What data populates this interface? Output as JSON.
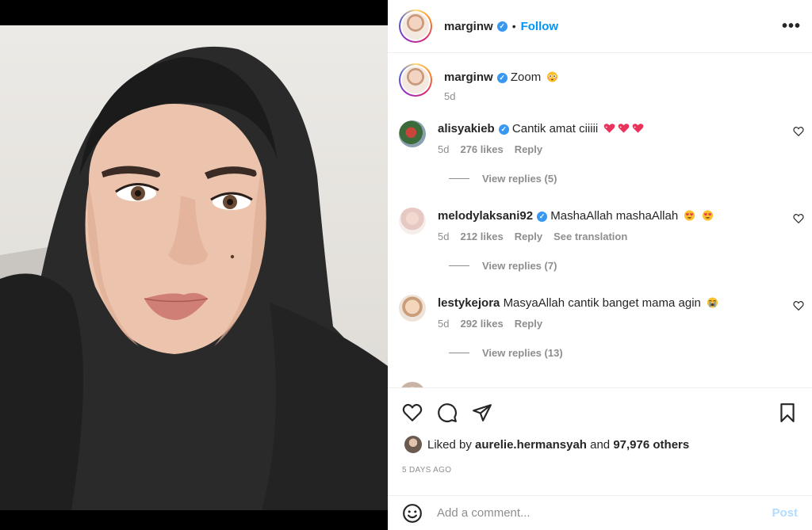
{
  "post": {
    "author": "marginw",
    "follow_label": "Follow",
    "separator": "•",
    "more_label": "•••"
  },
  "caption": {
    "username": "marginw",
    "text": "Zoom",
    "emoji": "flushed-face",
    "time": "5d"
  },
  "comments": [
    {
      "username": "alisyakieb",
      "verified": true,
      "text": "Cantik amat ciiiii",
      "emojis": [
        "heart-sparkle",
        "heart-sparkle",
        "heart-sparkle"
      ],
      "time": "5d",
      "likes": "276 likes",
      "reply_label": "Reply",
      "view_replies": "View replies (5)"
    },
    {
      "username": "melodylaksani92",
      "verified": true,
      "text": "MashaAllah mashaAllah",
      "emojis": [
        "heart-eyes",
        "heart-eyes"
      ],
      "time": "5d",
      "likes": "212 likes",
      "reply_label": "Reply",
      "translation_label": "See translation",
      "view_replies": "View replies (7)"
    },
    {
      "username": "lestykejora",
      "verified": false,
      "text": "MasyaAllah cantik banget mama agin",
      "emojis": [
        "crying-face"
      ],
      "time": "5d",
      "likes": "292 likes",
      "reply_label": "Reply",
      "view_replies": "View replies (13)"
    }
  ],
  "likes": {
    "prefix": "Liked by",
    "user": "aurelie.hermansyah",
    "conjunction": "and",
    "others": "97,976 others"
  },
  "timestamp": "5 DAYS AGO",
  "comment_box": {
    "placeholder": "Add a comment...",
    "post_label": "Post"
  },
  "colors": {
    "link": "#0095f6",
    "verified": "#3897f0",
    "muted": "#8e8e8e",
    "post_disabled": "#b3dbff",
    "emoji_heart": "#e8315b",
    "emoji_yellow": "#fbc02d"
  }
}
